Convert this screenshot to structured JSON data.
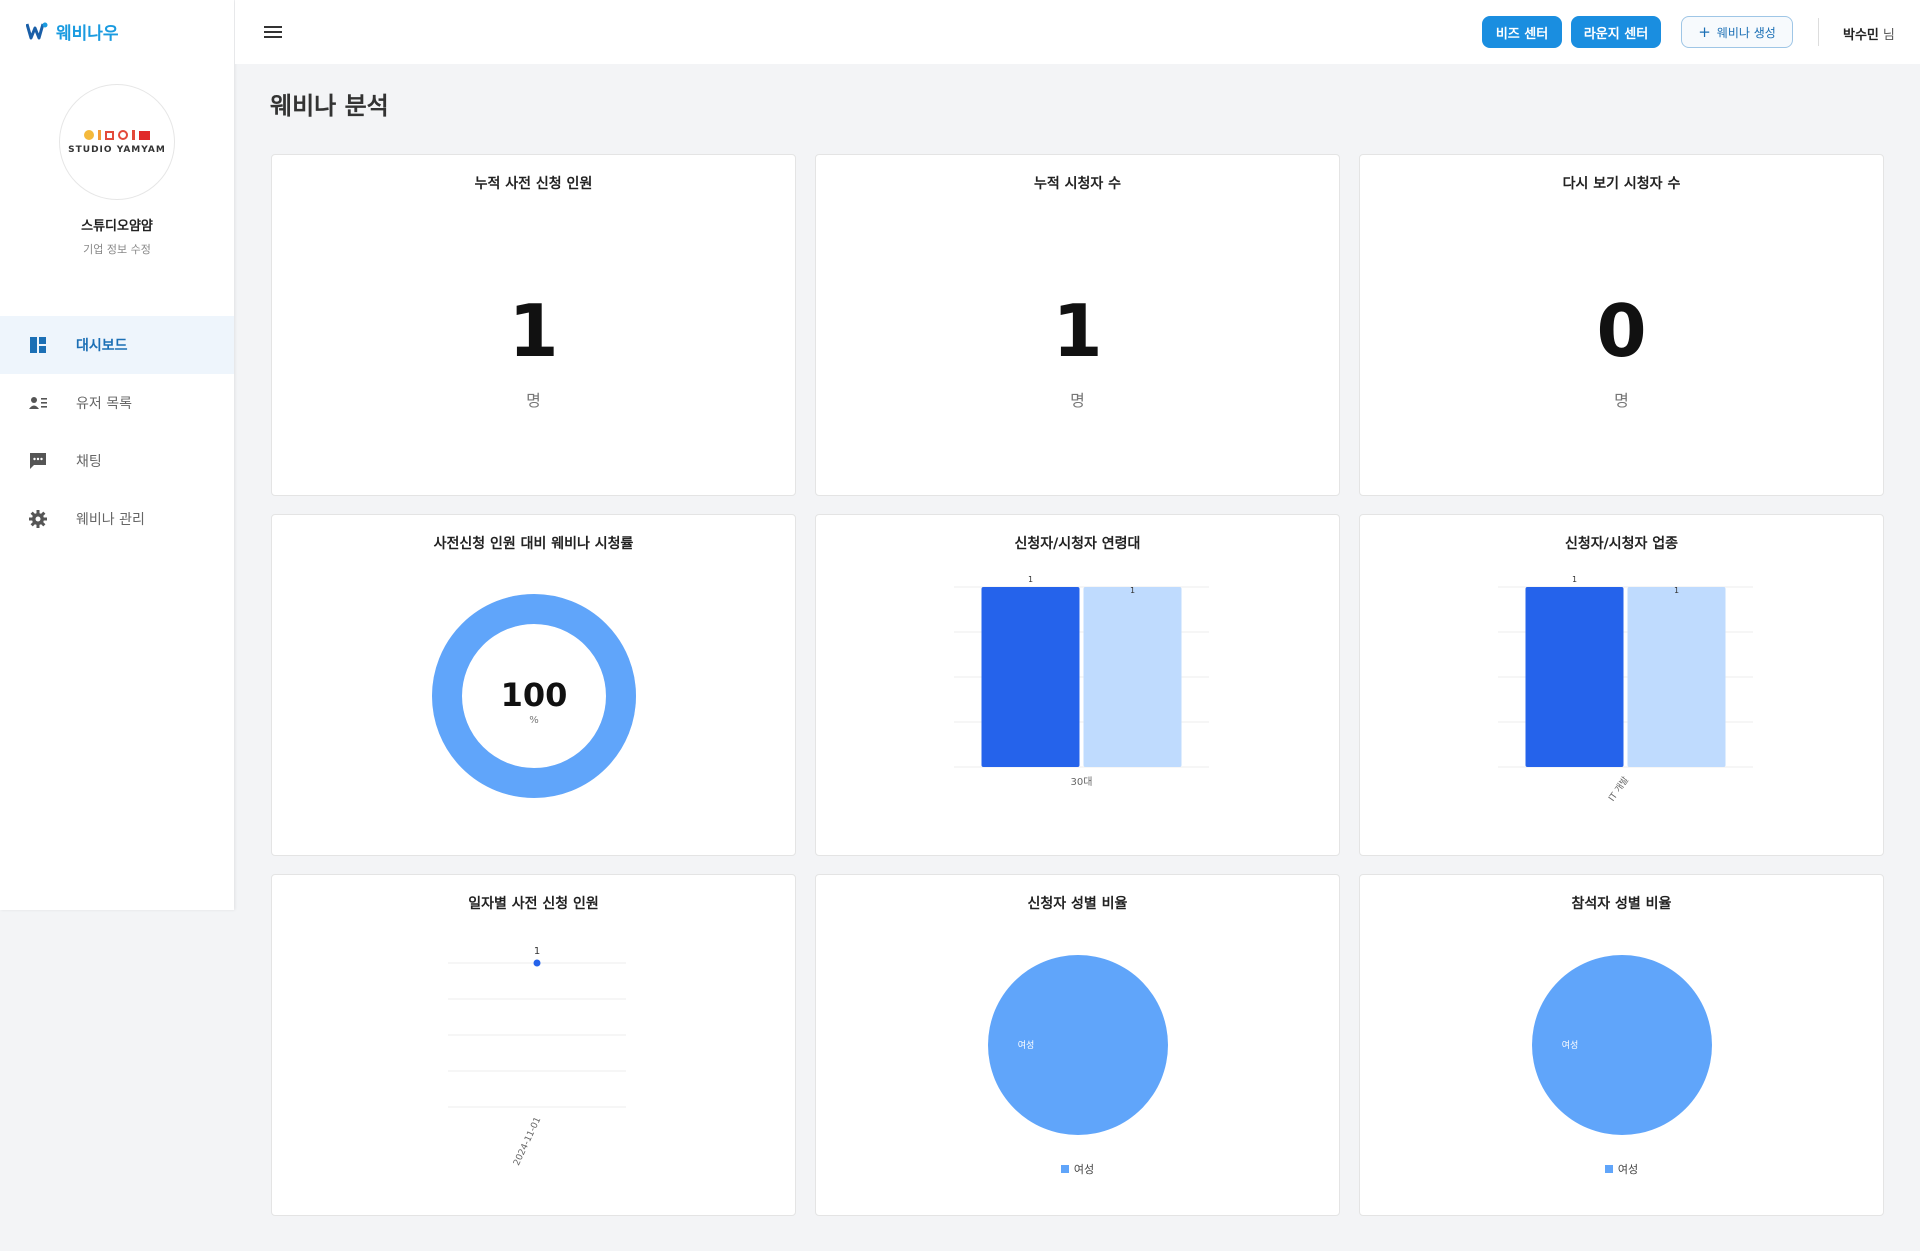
{
  "brand": {
    "name": "웨비나우"
  },
  "company": {
    "logo_text": "STUDIO YAMYAM",
    "name": "스튜디오얌얌",
    "edit_label": "기업 정보 수정"
  },
  "sidebar": {
    "items": [
      {
        "label": "대시보드",
        "icon": "dashboard-icon",
        "active": true
      },
      {
        "label": "유저 목록",
        "icon": "user-list-icon",
        "active": false
      },
      {
        "label": "채팅",
        "icon": "chat-icon",
        "active": false
      },
      {
        "label": "웨비나 관리",
        "icon": "gear-icon",
        "active": false
      }
    ]
  },
  "header": {
    "biz_center": "비즈 센터",
    "lounge_center": "라운지 센터",
    "create_webinar": "웨비나 생성",
    "user_name": "박수민",
    "user_suffix": "님"
  },
  "page": {
    "title": "웨비나 분석"
  },
  "colors": {
    "accent": "#1a8ee0",
    "bar_dark": "#2563eb",
    "bar_light": "#bfdbfe",
    "donut": "#60a5fa"
  },
  "cards": {
    "pre_registered": {
      "title": "누적 사전 신청 인원",
      "value": "1",
      "unit": "명"
    },
    "viewers": {
      "title": "누적 시청자 수",
      "value": "1",
      "unit": "명"
    },
    "replay_viewers": {
      "title": "다시 보기 시청자 수",
      "value": "0",
      "unit": "명"
    },
    "watch_rate": {
      "title": "사전신청 인원 대비 웨비나 시청률"
    },
    "age": {
      "title": "신청자/시청자 연령대"
    },
    "industry": {
      "title": "신청자/시청자 업종"
    },
    "daily": {
      "title": "일자별 사전 신청 인원"
    },
    "applicant_gender": {
      "title": "신청자 성별 비율",
      "legend": "여성"
    },
    "attendee_gender": {
      "title": "참석자 성별 비율",
      "legend": "여성"
    }
  },
  "chart_data": [
    {
      "type": "pie",
      "name": "watch_rate",
      "values": [
        100
      ],
      "center_label": "100",
      "center_unit": "%"
    },
    {
      "type": "bar",
      "name": "age",
      "categories": [
        "30대"
      ],
      "series": [
        {
          "values": [
            1
          ]
        },
        {
          "values": [
            1
          ]
        }
      ],
      "ylim": [
        0,
        1
      ]
    },
    {
      "type": "bar",
      "name": "industry",
      "categories": [
        "IT 개발"
      ],
      "series": [
        {
          "values": [
            1
          ]
        },
        {
          "values": [
            1
          ]
        }
      ],
      "ylim": [
        0,
        1
      ]
    },
    {
      "type": "line",
      "name": "daily",
      "x": [
        "2024-11-01"
      ],
      "series": [
        {
          "values": [
            1
          ]
        }
      ],
      "ylim": [
        0,
        1
      ]
    },
    {
      "type": "pie",
      "name": "applicant_gender",
      "categories": [
        "여성"
      ],
      "values": [
        1
      ]
    },
    {
      "type": "pie",
      "name": "attendee_gender",
      "categories": [
        "여성"
      ],
      "values": [
        1
      ]
    }
  ]
}
